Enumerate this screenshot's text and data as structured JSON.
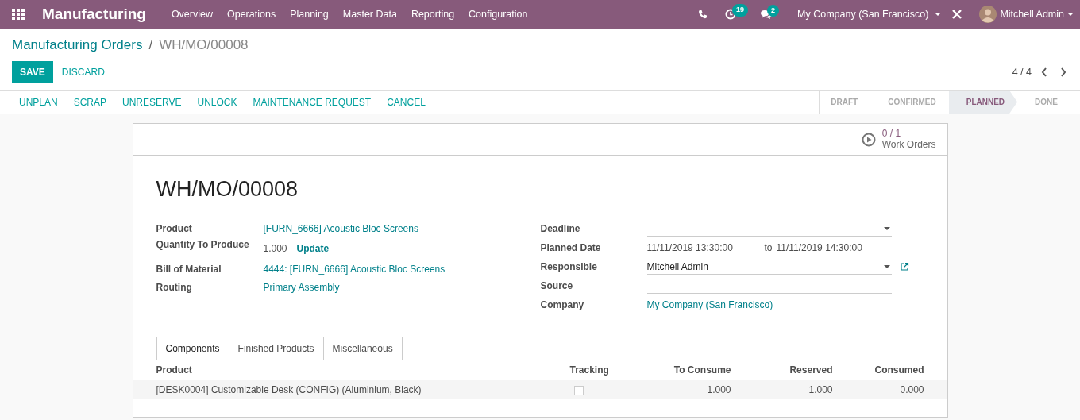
{
  "navbar": {
    "app": "Manufacturing",
    "menus": [
      "Overview",
      "Operations",
      "Planning",
      "Master Data",
      "Reporting",
      "Configuration"
    ],
    "activity_count": "19",
    "message_count": "2",
    "company": "My Company (San Francisco)",
    "user": "Mitchell Admin"
  },
  "breadcrumb": {
    "parent": "Manufacturing Orders",
    "separator": "/",
    "current": "WH/MO/00008"
  },
  "buttons": [
    {
      "label": "SAVE",
      "kind": "primary"
    },
    {
      "label": "DISCARD",
      "kind": "link"
    }
  ],
  "pager": "4 / 4",
  "actions": [
    "UNPLAN",
    "SCRAP",
    "UNRESERVE",
    "UNLOCK",
    "MAINTENANCE REQUEST",
    "CANCEL"
  ],
  "stages": [
    {
      "label": "DRAFT",
      "selected": false
    },
    {
      "label": "CONFIRMED",
      "selected": false
    },
    {
      "label": "PLANNED",
      "selected": true
    },
    {
      "label": "DONE",
      "selected": false
    }
  ],
  "smart_button": {
    "count": "0 / 1",
    "label": "Work Orders"
  },
  "title": "WH/MO/00008",
  "left_fields": [
    {
      "label": "Product",
      "kind": "link",
      "value": "[FURN_6666] Acoustic Bloc Screens"
    },
    {
      "label": "Quantity To Produce",
      "kind": "quantity",
      "value": "1.000",
      "action": "Update"
    },
    {
      "label": "Bill of Material",
      "kind": "link",
      "value": "4444: [FURN_6666] Acoustic Bloc Screens"
    },
    {
      "label": "Routing",
      "kind": "link",
      "value": "Primary Assembly"
    }
  ],
  "right_fields": [
    {
      "label": "Deadline",
      "kind": "select"
    },
    {
      "label": "Planned Date",
      "kind": "daterange",
      "value": "11/11/2019 13:30:00",
      "separator": "to",
      "value_end": "11/11/2019 14:30:00"
    },
    {
      "label": "Responsible",
      "kind": "select",
      "value": "Mitchell Admin",
      "external": true
    },
    {
      "label": "Source",
      "kind": "input"
    },
    {
      "label": "Company",
      "kind": "link",
      "value": "My Company (San Francisco)"
    }
  ],
  "tabs": [
    {
      "label": "Components",
      "selected": true
    },
    {
      "label": "Finished Products",
      "selected": false
    },
    {
      "label": "Miscellaneous",
      "selected": false
    }
  ],
  "table": {
    "columns": [
      "Product",
      "Tracking",
      "To Consume",
      "Reserved",
      "Consumed"
    ],
    "rows": [
      {
        "product": "[DESK0004] Customizable Desk (CONFIG) (Aluminium, Black)",
        "tracking": false,
        "to_consume": "1.000",
        "reserved": "1.000",
        "consumed": "0.000"
      }
    ]
  }
}
